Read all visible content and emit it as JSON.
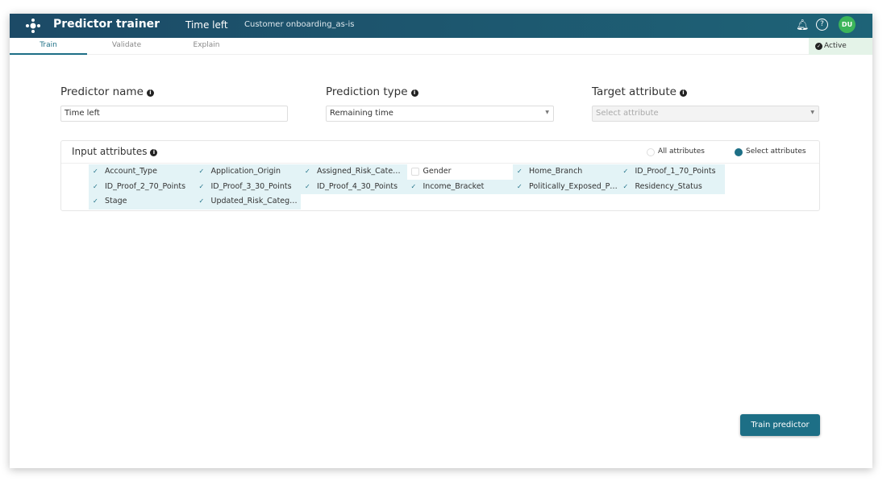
{
  "header": {
    "app_title": "Predictor trainer",
    "predictor_name": "Time left",
    "process_name": "Customer onboarding_as-is",
    "avatar_initials": "DU",
    "icons": [
      "logo-icon",
      "bell-icon",
      "help-icon"
    ]
  },
  "tabs": [
    {
      "label": "Train",
      "active": true
    },
    {
      "label": "Validate"
    },
    {
      "label": "Explain"
    }
  ],
  "status": {
    "label": "Active"
  },
  "form": {
    "predictor_name": {
      "label": "Predictor name",
      "value": "Time left"
    },
    "prediction_type": {
      "label": "Prediction type",
      "value": "Remaining time"
    },
    "target_attribute": {
      "label": "Target attribute",
      "placeholder": "Select attribute"
    }
  },
  "input_attributes": {
    "title": "Input attributes",
    "options": [
      {
        "label": "All attributes",
        "selected": false
      },
      {
        "label": "Select attributes",
        "selected": true
      }
    ],
    "items": [
      {
        "label": "Account_Type",
        "checked": true
      },
      {
        "label": "Application_Origin",
        "checked": true
      },
      {
        "label": "Assigned_Risk_Cate…",
        "checked": true
      },
      {
        "label": "Gender",
        "checked": false
      },
      {
        "label": "Home_Branch",
        "checked": true
      },
      {
        "label": "ID_Proof_1_70_Points",
        "checked": true
      },
      {
        "label": "ID_Proof_2_70_Points",
        "checked": true
      },
      {
        "label": "ID_Proof_3_30_Points",
        "checked": true
      },
      {
        "label": "ID_Proof_4_30_Points",
        "checked": true
      },
      {
        "label": "Income_Bracket",
        "checked": true
      },
      {
        "label": "Politically_Exposed_P…",
        "checked": true
      },
      {
        "label": "Residency_Status",
        "checked": true
      },
      {
        "label": "Stage",
        "checked": true
      },
      {
        "label": "Updated_Risk_Categ…",
        "checked": true
      }
    ]
  },
  "actions": {
    "train_label": "Train predictor"
  },
  "colors": {
    "header": "#1c4a66",
    "accent": "#1d6f86",
    "active_bg": "#e4f3e8",
    "avatar": "#3cb55a"
  }
}
